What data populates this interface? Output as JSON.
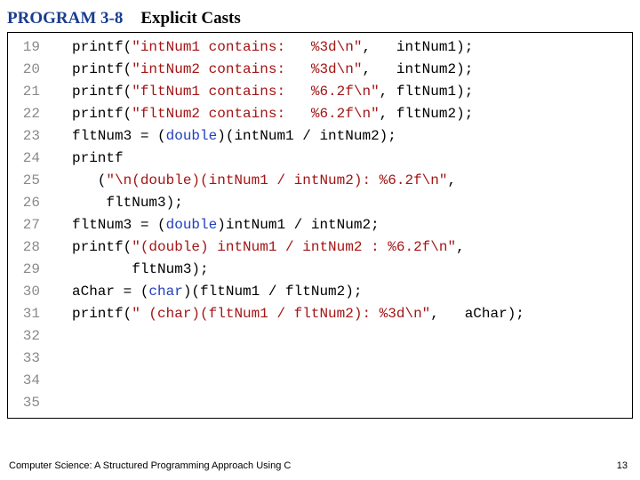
{
  "header": {
    "program_label": "PROGRAM 3-8",
    "program_title": "Explicit Casts"
  },
  "gutter": {
    "lines": [
      "19",
      "20",
      "21",
      "22",
      "23",
      "24",
      "25",
      "26",
      "27",
      "28",
      "29",
      "30",
      "31",
      "32",
      "33",
      "34",
      "35"
    ]
  },
  "code": {
    "l19a": "printf(",
    "l19s": "\"intNum1 contains:   %3d\\n\"",
    "l19b": ",   intNum1);",
    "l20a": "printf(",
    "l20s": "\"intNum2 contains:   %3d\\n\"",
    "l20b": ",   intNum2);",
    "l21a": "printf(",
    "l21s": "\"fltNum1 contains:   %6.2f\\n\"",
    "l21b": ", fltNum1);",
    "l22a": "printf(",
    "l22s": "\"fltNum2 contains:   %6.2f\\n\"",
    "l22b": ", fltNum2);",
    "l23": "",
    "l24a": "fltNum3 = (",
    "l24k": "double",
    "l24b": ")(intNum1 / intNum2);",
    "l25": "printf",
    "l26a": "   (",
    "l26s": "\"\\n(double)(intNum1 / intNum2): %6.2f\\n\"",
    "l26b": ",",
    "l27": "    fltNum3);",
    "l28": "",
    "l29a": "fltNum3 = (",
    "l29k": "double",
    "l29b": ")intNum1 / intNum2;",
    "l30a": "printf(",
    "l30s": "\"(double) intNum1 / intNum2 : %6.2f\\n\"",
    "l30b": ",",
    "l31": "       fltNum3);",
    "l32": "",
    "l33a": "aChar = (",
    "l33k": "char",
    "l33b": ")(fltNum1 / fltNum2);",
    "l34a": "printf(",
    "l34s": "\" (char)(fltNum1 / fltNum2): %3d\\n\"",
    "l34b": ",   aChar);",
    "l35": ""
  },
  "footer": {
    "book": "Computer Science: A Structured Programming Approach Using C",
    "page": "13"
  }
}
